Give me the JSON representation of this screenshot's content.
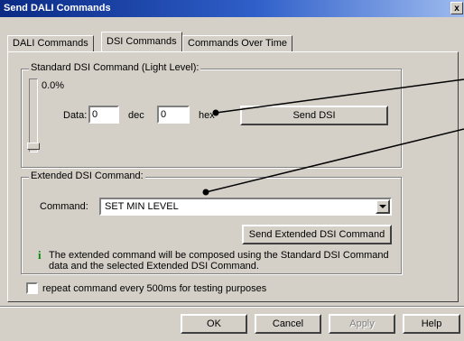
{
  "window": {
    "title": "Send DALI Commands",
    "close_glyph": "x"
  },
  "tabs": [
    {
      "label": "DALI Commands"
    },
    {
      "label": "DSI Commands"
    },
    {
      "label": "Commands Over Time"
    }
  ],
  "standard_dsi": {
    "title": "Standard DSI Command (Light Level):",
    "level_text": "0.0%",
    "level_fraction": 0.0,
    "data_label": "Data:",
    "dec_value": "0",
    "dec_label": "dec",
    "hex_value": "0",
    "hex_label": "hex",
    "send_button": "Send DSI"
  },
  "extended_dsi": {
    "title": "Extended DSI Command:",
    "command_label": "Command:",
    "command_value": "SET MIN LEVEL",
    "send_button": "Send Extended DSI Command",
    "info_text_line1": "The extended command will be composed using the Standard DSI Command",
    "info_text_line2": "data and the selected Extended DSI Command."
  },
  "repeat": {
    "label": "repeat command every 500ms for testing purposes",
    "checked": false
  },
  "buttons": {
    "ok": "OK",
    "cancel": "Cancel",
    "apply": "Apply",
    "help": "Help"
  },
  "icons": {
    "info": "info-icon",
    "dropdown": "chevron-down-icon"
  },
  "colors": {
    "titlebar_start": "#0a2a84",
    "titlebar_end": "#9ebbef",
    "face": "#d4d0c8",
    "info_icon": "#0a8a0a"
  }
}
